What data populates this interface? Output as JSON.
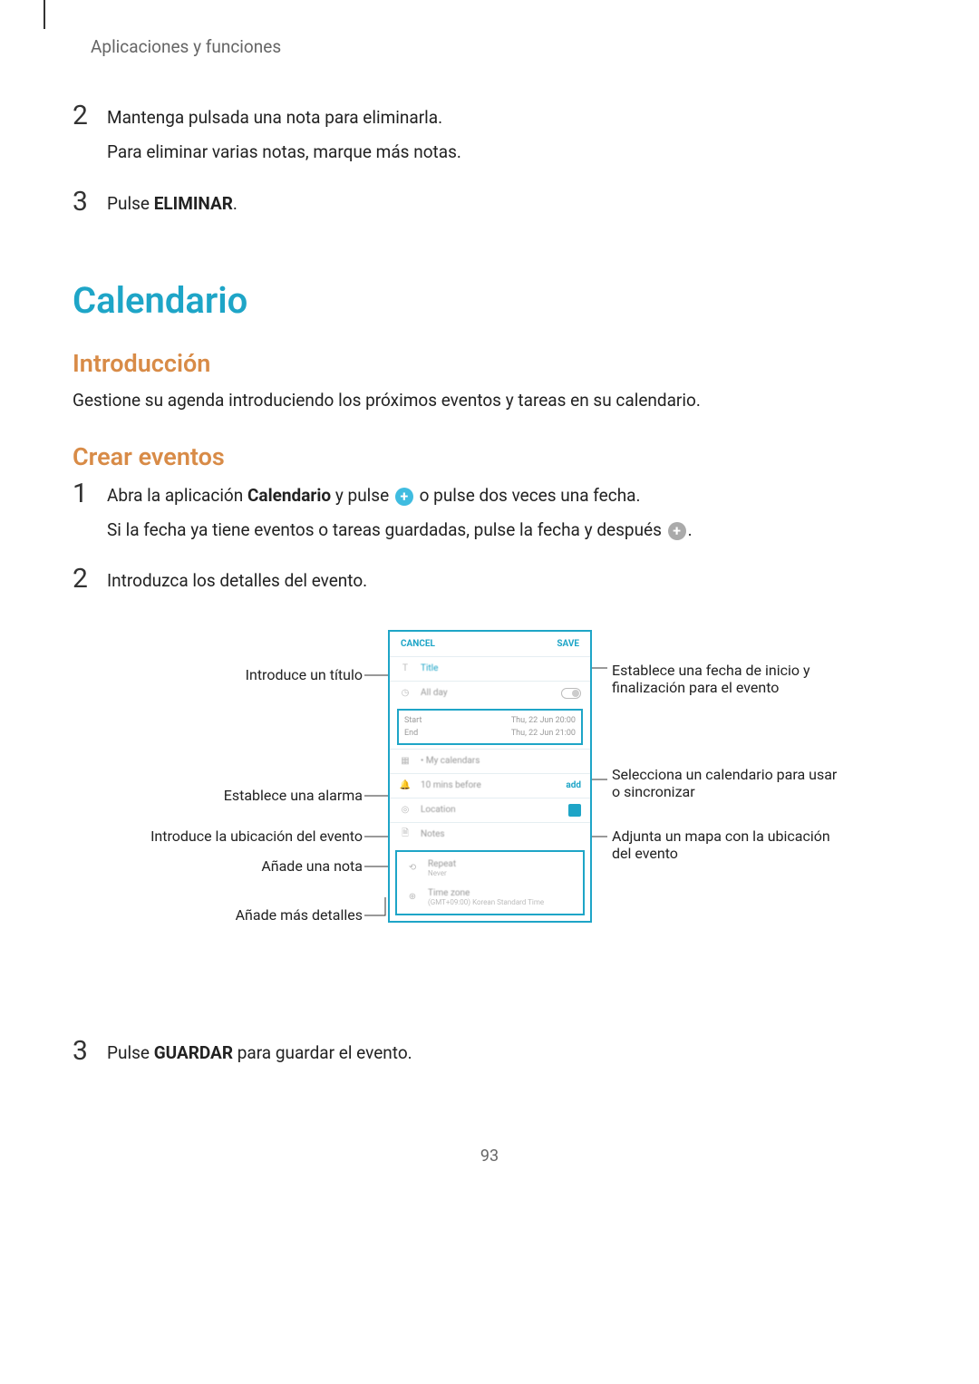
{
  "header": {
    "section": "Aplicaciones y funciones"
  },
  "steps_top": [
    {
      "num": "2",
      "lines": [
        "Mantenga pulsada una nota para eliminarla.",
        "Para eliminar varias notas, marque más notas."
      ]
    },
    {
      "num": "3",
      "prefix": "Pulse ",
      "bold": "ELIMINAR",
      "suffix": "."
    }
  ],
  "h1": "Calendario",
  "h2a": "Introducción",
  "intro": "Gestione su agenda introduciendo los próximos eventos y tareas en su calendario.",
  "h2b": "Crear eventos",
  "steps_create": {
    "s1": {
      "num": "1",
      "l1a": "Abra la aplicación ",
      "l1b": "Calendario",
      "l1c": " y pulse ",
      "l1d": " o pulse dos veces una fecha.",
      "l2a": "Si la fecha ya tiene eventos o tareas guardadas, pulse la fecha y después ",
      "l2b": "."
    },
    "s2": {
      "num": "2",
      "text": "Introduzca los detalles del evento."
    },
    "s3": {
      "num": "3",
      "prefix": "Pulse ",
      "bold": "GUARDAR",
      "suffix": " para guardar el evento."
    }
  },
  "annotations": {
    "left": {
      "title": "Introduce un título",
      "alarm": "Establece una alarma",
      "location": "Introduce la ubicación del evento",
      "note": "Añade una nota",
      "more": "Añade más detalles"
    },
    "right": {
      "dates": "Establece una fecha de inicio y finalización para el evento",
      "calendar": "Selecciona un calendario para usar o sincronizar",
      "map": "Adjunta un mapa con la ubicación del evento"
    }
  },
  "phone": {
    "cancel": "CANCEL",
    "save": "SAVE",
    "title_ph": "Title",
    "allday": "All day",
    "start": "Start",
    "start_val": "Thu, 22 Jun   20:00",
    "end": "End",
    "end_val": "Thu, 22 Jun   21:00",
    "mycal": "• My calendars",
    "reminder": "10 mins before",
    "reminder_action": "add",
    "location": "Location",
    "notes": "Notes",
    "repeat": "Repeat",
    "repeat_val": "Never",
    "tz": "Time zone",
    "tz_val": "(GMT+09:00) Korean Standard Time"
  },
  "page": "93"
}
